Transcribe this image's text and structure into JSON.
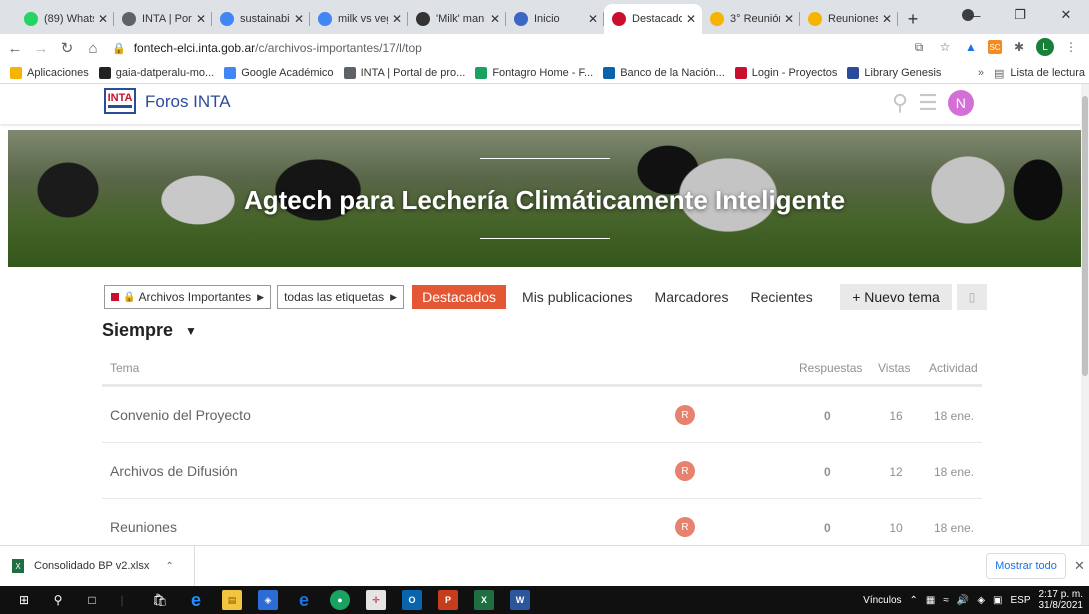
{
  "browser": {
    "tabs": [
      {
        "title": "(89) Whats",
        "favicon_color": "#25d366",
        "active": false
      },
      {
        "title": "INTA | Port",
        "favicon_color": "#5f6368",
        "active": false
      },
      {
        "title": "sustainabil",
        "favicon_color": "#4285f4",
        "active": false
      },
      {
        "title": "milk vs veg",
        "favicon_color": "#4285f4",
        "active": false
      },
      {
        "title": "'Milk' man",
        "favicon_color": "#333333",
        "active": false
      },
      {
        "title": "Inicio",
        "favicon_color": "#3b66c4",
        "active": false
      },
      {
        "title": "Destacado",
        "favicon_color": "#c8102e",
        "active": true
      },
      {
        "title": "3° Reunión",
        "favicon_color": "#f4b400",
        "active": false
      },
      {
        "title": "Reuniones",
        "favicon_color": "#f4b400",
        "active": false
      }
    ],
    "new_tab_symbol": "+",
    "url_host": "fontech-elci.inta.gob.ar",
    "url_path": "/c/archivos-importantes/17/l/top",
    "bookmarks": [
      {
        "label": "Aplicaciones",
        "icon": "apps-grid-icon"
      },
      {
        "label": "gaia-datperalu-mo...",
        "icon": "gaia-icon"
      },
      {
        "label": "Google Académico",
        "icon": "scholar-icon"
      },
      {
        "label": "INTA | Portal de pro...",
        "icon": "globe-icon"
      },
      {
        "label": "Fontagro Home - F...",
        "icon": "fontagro-icon"
      },
      {
        "label": "Banco de la Nación...",
        "icon": "bank-icon"
      },
      {
        "label": "Login - Proyectos",
        "icon": "inta-icon"
      },
      {
        "label": "Library Genesis",
        "icon": "library-icon"
      }
    ],
    "bookmarks_more": "»",
    "reading_list": "Lista de lectura"
  },
  "site": {
    "logo_text": "INTA",
    "title": "Foros INTA",
    "avatar_letter": "N",
    "banner_title": "Agtech para Lechería Climáticamente Inteligente"
  },
  "nav": {
    "category": "Archivos Importantes",
    "tags": "todas las etiquetas",
    "links": [
      "Destacados",
      "Mis publicaciones",
      "Marcadores",
      "Recientes"
    ],
    "new_topic": "+ Nuevo tema"
  },
  "period": "Siempre",
  "table": {
    "headers": {
      "topic": "Tema",
      "replies": "Respuestas",
      "views": "Vistas",
      "activity": "Actividad"
    },
    "rows": [
      {
        "title": "Convenio del Proyecto",
        "poster": "R",
        "replies": "0",
        "views": "16",
        "activity": "18 ene."
      },
      {
        "title": "Archivos de Difusión",
        "poster": "R",
        "replies": "0",
        "views": "12",
        "activity": "18 ene."
      },
      {
        "title": "Reuniones",
        "poster": "R",
        "replies": "0",
        "views": "10",
        "activity": "18 ene."
      }
    ]
  },
  "downloads": {
    "file": "Consolidado BP v2.xlsx",
    "show_all": "Mostrar todo"
  },
  "taskbar": {
    "links_label": "Vínculos",
    "language": "ESP",
    "time": "2:17 p. m.",
    "date": "31/8/2021"
  }
}
